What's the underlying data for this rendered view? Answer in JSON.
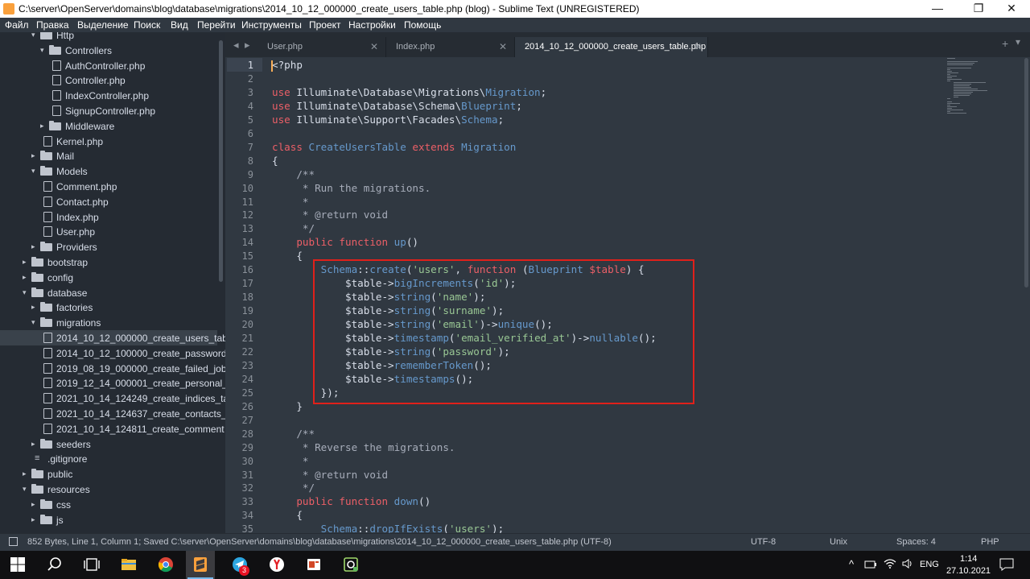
{
  "window": {
    "title": "C:\\server\\OpenServer\\domains\\blog\\database\\migrations\\2014_10_12_000000_create_users_table.php (blog) - Sublime Text (UNREGISTERED)",
    "minimize": "—",
    "maximize": "❐",
    "close": "✕"
  },
  "menu": [
    "Файл",
    "Правка",
    "Выделение",
    "Поиск",
    "Вид",
    "Перейти",
    "Инструменты",
    "Проект",
    "Настройки",
    "Помощь"
  ],
  "sidebar": {
    "items": [
      {
        "label": "Http",
        "kind": "folder",
        "open": true,
        "depth": 3
      },
      {
        "label": "Controllers",
        "kind": "folder",
        "open": true,
        "depth": 4
      },
      {
        "label": "AuthController.php",
        "kind": "file",
        "depth": 5
      },
      {
        "label": "Controller.php",
        "kind": "file",
        "depth": 5
      },
      {
        "label": "IndexController.php",
        "kind": "file",
        "depth": 5
      },
      {
        "label": "SignupController.php",
        "kind": "file",
        "depth": 5
      },
      {
        "label": "Middleware",
        "kind": "folder",
        "open": false,
        "depth": 4
      },
      {
        "label": "Kernel.php",
        "kind": "file",
        "depth": 4
      },
      {
        "label": "Mail",
        "kind": "folder",
        "open": false,
        "depth": 3
      },
      {
        "label": "Models",
        "kind": "folder",
        "open": true,
        "depth": 3
      },
      {
        "label": "Comment.php",
        "kind": "file",
        "depth": 4
      },
      {
        "label": "Contact.php",
        "kind": "file",
        "depth": 4
      },
      {
        "label": "Index.php",
        "kind": "file",
        "depth": 4
      },
      {
        "label": "User.php",
        "kind": "file",
        "depth": 4
      },
      {
        "label": "Providers",
        "kind": "folder",
        "open": false,
        "depth": 3
      },
      {
        "label": "bootstrap",
        "kind": "folder",
        "open": false,
        "depth": 2
      },
      {
        "label": "config",
        "kind": "folder",
        "open": false,
        "depth": 2
      },
      {
        "label": "database",
        "kind": "folder",
        "open": true,
        "depth": 2
      },
      {
        "label": "factories",
        "kind": "folder",
        "open": false,
        "depth": 3
      },
      {
        "label": "migrations",
        "kind": "folder",
        "open": true,
        "depth": 3
      },
      {
        "label": "2014_10_12_000000_create_users_tab",
        "kind": "file",
        "depth": 4,
        "selected": true
      },
      {
        "label": "2014_10_12_100000_create_password",
        "kind": "file",
        "depth": 4
      },
      {
        "label": "2019_08_19_000000_create_failed_job",
        "kind": "file",
        "depth": 4
      },
      {
        "label": "2019_12_14_000001_create_personal_",
        "kind": "file",
        "depth": 4
      },
      {
        "label": "2021_10_14_124249_create_indices_ta",
        "kind": "file",
        "depth": 4
      },
      {
        "label": "2021_10_14_124637_create_contacts_",
        "kind": "file",
        "depth": 4
      },
      {
        "label": "2021_10_14_124811_create_comment",
        "kind": "file",
        "depth": 4
      },
      {
        "label": "seeders",
        "kind": "folder",
        "open": false,
        "depth": 3
      },
      {
        "label": ".gitignore",
        "kind": "text",
        "depth": 3
      },
      {
        "label": "public",
        "kind": "folder",
        "open": false,
        "depth": 2
      },
      {
        "label": "resources",
        "kind": "folder",
        "open": true,
        "depth": 2
      },
      {
        "label": "css",
        "kind": "folder",
        "open": false,
        "depth": 3
      },
      {
        "label": "js",
        "kind": "folder",
        "open": false,
        "depth": 3
      }
    ]
  },
  "tabs": [
    {
      "label": "User.php",
      "active": false
    },
    {
      "label": "Index.php",
      "active": false
    },
    {
      "label": "2014_10_12_000000_create_users_table.php",
      "active": true
    }
  ],
  "tab_bar": {
    "plus": "+",
    "chevron": "▾",
    "close": "✕"
  },
  "editor": {
    "lines": [
      [
        [
          "k",
          "<?php"
        ]
      ],
      [],
      [
        [
          "kw",
          "use "
        ],
        [
          "t",
          "Illuminate\\Database\\Migrations\\"
        ],
        [
          "cls",
          "Migration"
        ],
        [
          "t",
          ";"
        ]
      ],
      [
        [
          "kw",
          "use "
        ],
        [
          "t",
          "Illuminate\\Database\\Schema\\"
        ],
        [
          "cls",
          "Blueprint"
        ],
        [
          "t",
          ";"
        ]
      ],
      [
        [
          "kw",
          "use "
        ],
        [
          "t",
          "Illuminate\\Support\\Facades\\"
        ],
        [
          "cls",
          "Schema"
        ],
        [
          "t",
          ";"
        ]
      ],
      [],
      [
        [
          "kw",
          "class "
        ],
        [
          "cls",
          "CreateUsersTable "
        ],
        [
          "kw",
          "extends "
        ],
        [
          "cls",
          "Migration"
        ]
      ],
      [
        [
          "t",
          "{"
        ]
      ],
      [
        [
          "t",
          "    "
        ],
        [
          "cm",
          "/**"
        ]
      ],
      [
        [
          "t",
          "    "
        ],
        [
          "cm",
          " * Run the migrations."
        ]
      ],
      [
        [
          "t",
          "    "
        ],
        [
          "cm",
          " *"
        ]
      ],
      [
        [
          "t",
          "    "
        ],
        [
          "cm",
          " * @return void"
        ]
      ],
      [
        [
          "t",
          "    "
        ],
        [
          "cm",
          " */"
        ]
      ],
      [
        [
          "t",
          "    "
        ],
        [
          "kw",
          "public function "
        ],
        [
          "fn",
          "up"
        ],
        [
          "t",
          "()"
        ]
      ],
      [
        [
          "t",
          "    {"
        ]
      ],
      [
        [
          "t",
          "        "
        ],
        [
          "cls",
          "Schema"
        ],
        [
          "t",
          "::"
        ],
        [
          "fn",
          "create"
        ],
        [
          "t",
          "("
        ],
        [
          "str",
          "'users'"
        ],
        [
          "t",
          ", "
        ],
        [
          "kw",
          "function "
        ],
        [
          "t",
          "("
        ],
        [
          "cls",
          "Blueprint "
        ],
        [
          "kw",
          "$table"
        ],
        [
          "t",
          ") {"
        ]
      ],
      [
        [
          "t",
          "            $table->"
        ],
        [
          "fn",
          "bigIncrements"
        ],
        [
          "t",
          "("
        ],
        [
          "str",
          "'id'"
        ],
        [
          "t",
          ");"
        ]
      ],
      [
        [
          "t",
          "            $table->"
        ],
        [
          "fn",
          "string"
        ],
        [
          "t",
          "("
        ],
        [
          "str",
          "'name'"
        ],
        [
          "t",
          ");"
        ]
      ],
      [
        [
          "t",
          "            $table->"
        ],
        [
          "fn",
          "string"
        ],
        [
          "t",
          "("
        ],
        [
          "str",
          "'surname'"
        ],
        [
          "t",
          ");"
        ]
      ],
      [
        [
          "t",
          "            $table->"
        ],
        [
          "fn",
          "string"
        ],
        [
          "t",
          "("
        ],
        [
          "str",
          "'email'"
        ],
        [
          "t",
          ")->"
        ],
        [
          "fn",
          "unique"
        ],
        [
          "t",
          "();"
        ]
      ],
      [
        [
          "t",
          "            $table->"
        ],
        [
          "fn",
          "timestamp"
        ],
        [
          "t",
          "("
        ],
        [
          "str",
          "'email_verified_at'"
        ],
        [
          "t",
          ")->"
        ],
        [
          "fn",
          "nullable"
        ],
        [
          "t",
          "();"
        ]
      ],
      [
        [
          "t",
          "            $table->"
        ],
        [
          "fn",
          "string"
        ],
        [
          "t",
          "("
        ],
        [
          "str",
          "'password'"
        ],
        [
          "t",
          ");"
        ]
      ],
      [
        [
          "t",
          "            $table->"
        ],
        [
          "fn",
          "rememberToken"
        ],
        [
          "t",
          "();"
        ]
      ],
      [
        [
          "t",
          "            $table->"
        ],
        [
          "fn",
          "timestamps"
        ],
        [
          "t",
          "();"
        ]
      ],
      [
        [
          "t",
          "        });"
        ]
      ],
      [
        [
          "t",
          "    }"
        ]
      ],
      [],
      [
        [
          "t",
          "    "
        ],
        [
          "cm",
          "/**"
        ]
      ],
      [
        [
          "t",
          "    "
        ],
        [
          "cm",
          " * Reverse the migrations."
        ]
      ],
      [
        [
          "t",
          "    "
        ],
        [
          "cm",
          " *"
        ]
      ],
      [
        [
          "t",
          "    "
        ],
        [
          "cm",
          " * @return void"
        ]
      ],
      [
        [
          "t",
          "    "
        ],
        [
          "cm",
          " */"
        ]
      ],
      [
        [
          "t",
          "    "
        ],
        [
          "kw",
          "public function "
        ],
        [
          "fn",
          "down"
        ],
        [
          "t",
          "()"
        ]
      ],
      [
        [
          "t",
          "    {"
        ]
      ],
      [
        [
          "t",
          "        "
        ],
        [
          "cls",
          "Schema"
        ],
        [
          "t",
          "::"
        ],
        [
          "fn",
          "dropIfExists"
        ],
        [
          "t",
          "("
        ],
        [
          "str",
          "'users'"
        ],
        [
          "t",
          ");"
        ]
      ]
    ]
  },
  "status": {
    "info": "852 Bytes, Line 1, Column 1; Saved C:\\server\\OpenServer\\domains\\blog\\database\\migrations\\2014_10_12_000000_create_users_table.php (UTF-8)",
    "encoding": "UTF-8",
    "line_endings": "Unix",
    "indent": "Spaces: 4",
    "syntax": "PHP"
  },
  "taskbar": {
    "badge": "3",
    "tray_expand": "^",
    "lang": "ENG",
    "time": "1:14",
    "date": "27.10.2021"
  },
  "colors": {
    "accent_red_box": "#e0201a",
    "editor_bg": "#303841",
    "sidebar_bg": "#252b33"
  }
}
